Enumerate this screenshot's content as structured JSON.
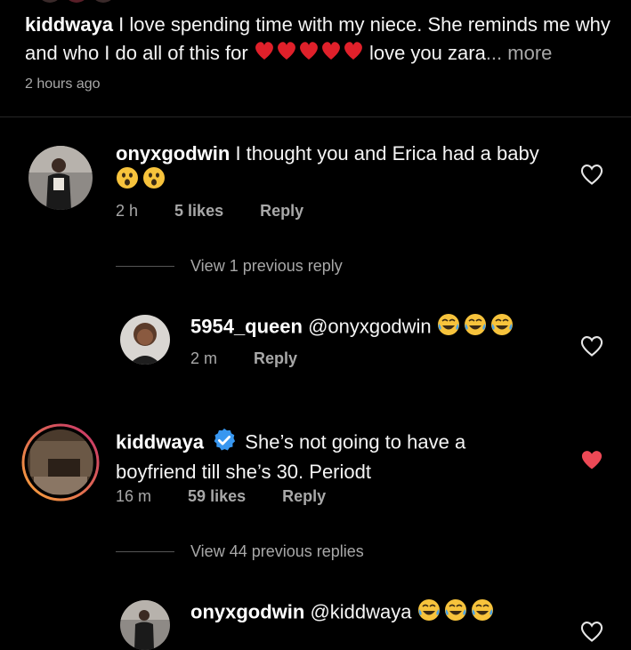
{
  "caption": {
    "username": "kiddwaya",
    "text_line1": "I love spending time with my niece. She reminds me why",
    "text_line2_prefix": "and who I do all of this for",
    "text_line2_suffix": "love you zara",
    "ellipsis": "...",
    "more": "more",
    "time": "2 hours ago"
  },
  "comments": [
    {
      "username": "onyxgodwin",
      "text": "I thought you and Erica had a baby",
      "time": "2 h",
      "likes": "5 likes",
      "reply": "Reply",
      "liked": false,
      "emoji": "astonished-face"
    },
    {
      "username": "5954_queen",
      "mention": "@onyxgodwin",
      "time": "2 m",
      "reply": "Reply",
      "liked": false,
      "emoji": "tears-of-joy-face"
    },
    {
      "username": "kiddwaya",
      "verified": true,
      "text_line1": "She’s not going to have a",
      "text_line2": "boyfriend till she’s 30. Periodt",
      "time": "16 m",
      "likes": "59 likes",
      "reply": "Reply",
      "liked": true
    },
    {
      "username": "onyxgodwin",
      "mention": "@kiddwaya",
      "liked": false,
      "emoji": "tears-of-joy-face"
    }
  ],
  "view_replies": [
    "View 1 previous reply",
    "View 44 previous replies"
  ],
  "colors": {
    "background": "#000000",
    "text": "#f5f5f5",
    "muted": "#a8a8a8",
    "liked_heart": "#ed4956",
    "verified": "#3897f0",
    "story_ring_start": "#f9a43a",
    "story_ring_end": "#c6306b"
  }
}
